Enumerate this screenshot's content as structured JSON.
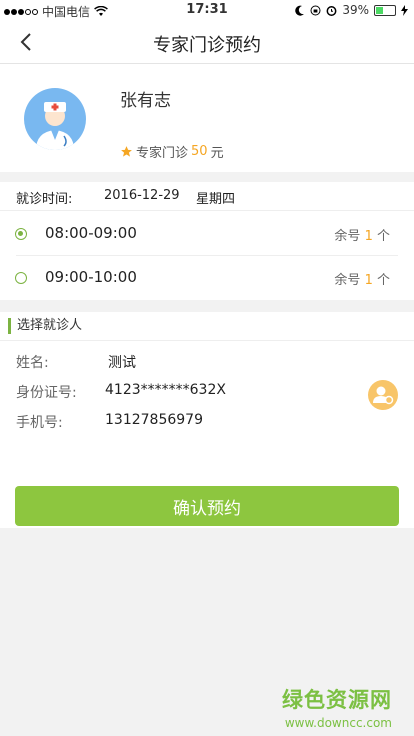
{
  "status_bar": {
    "carrier": "中国电信",
    "time": "17:31",
    "battery": "39%",
    "battery_level": 0.39
  },
  "nav": {
    "title": "专家门诊预约",
    "back_icon": "chevron-left-icon"
  },
  "doctor": {
    "name": "张有志",
    "fee_label": "专家门诊",
    "fee_amount": "50",
    "fee_unit": "元",
    "star_color": "#f5a623"
  },
  "visit": {
    "label": "就诊时间:",
    "date": "2016-12-29",
    "weekday": "星期四"
  },
  "slots": [
    {
      "time": "08:00-09:00",
      "remain_label": "余号",
      "remain_count": "1",
      "remain_unit": "个",
      "selected": true
    },
    {
      "time": "09:00-10:00",
      "remain_label": "余号",
      "remain_count": "1",
      "remain_unit": "个",
      "selected": false
    }
  ],
  "patient": {
    "section_title": "选择就诊人",
    "name_label": "姓名:",
    "name_value": "测试",
    "id_label": "身份证号:",
    "id_value": "4123*******632X",
    "phone_label": "手机号:",
    "phone_value": "13127856979",
    "contact_icon": "contact-card-icon"
  },
  "confirm_button": {
    "label": "确认预约"
  },
  "watermark": {
    "title": "绿色资源网",
    "url": "www.downcc.com"
  },
  "colors": {
    "accent": "#8dc63f",
    "highlight": "#f5a623"
  }
}
